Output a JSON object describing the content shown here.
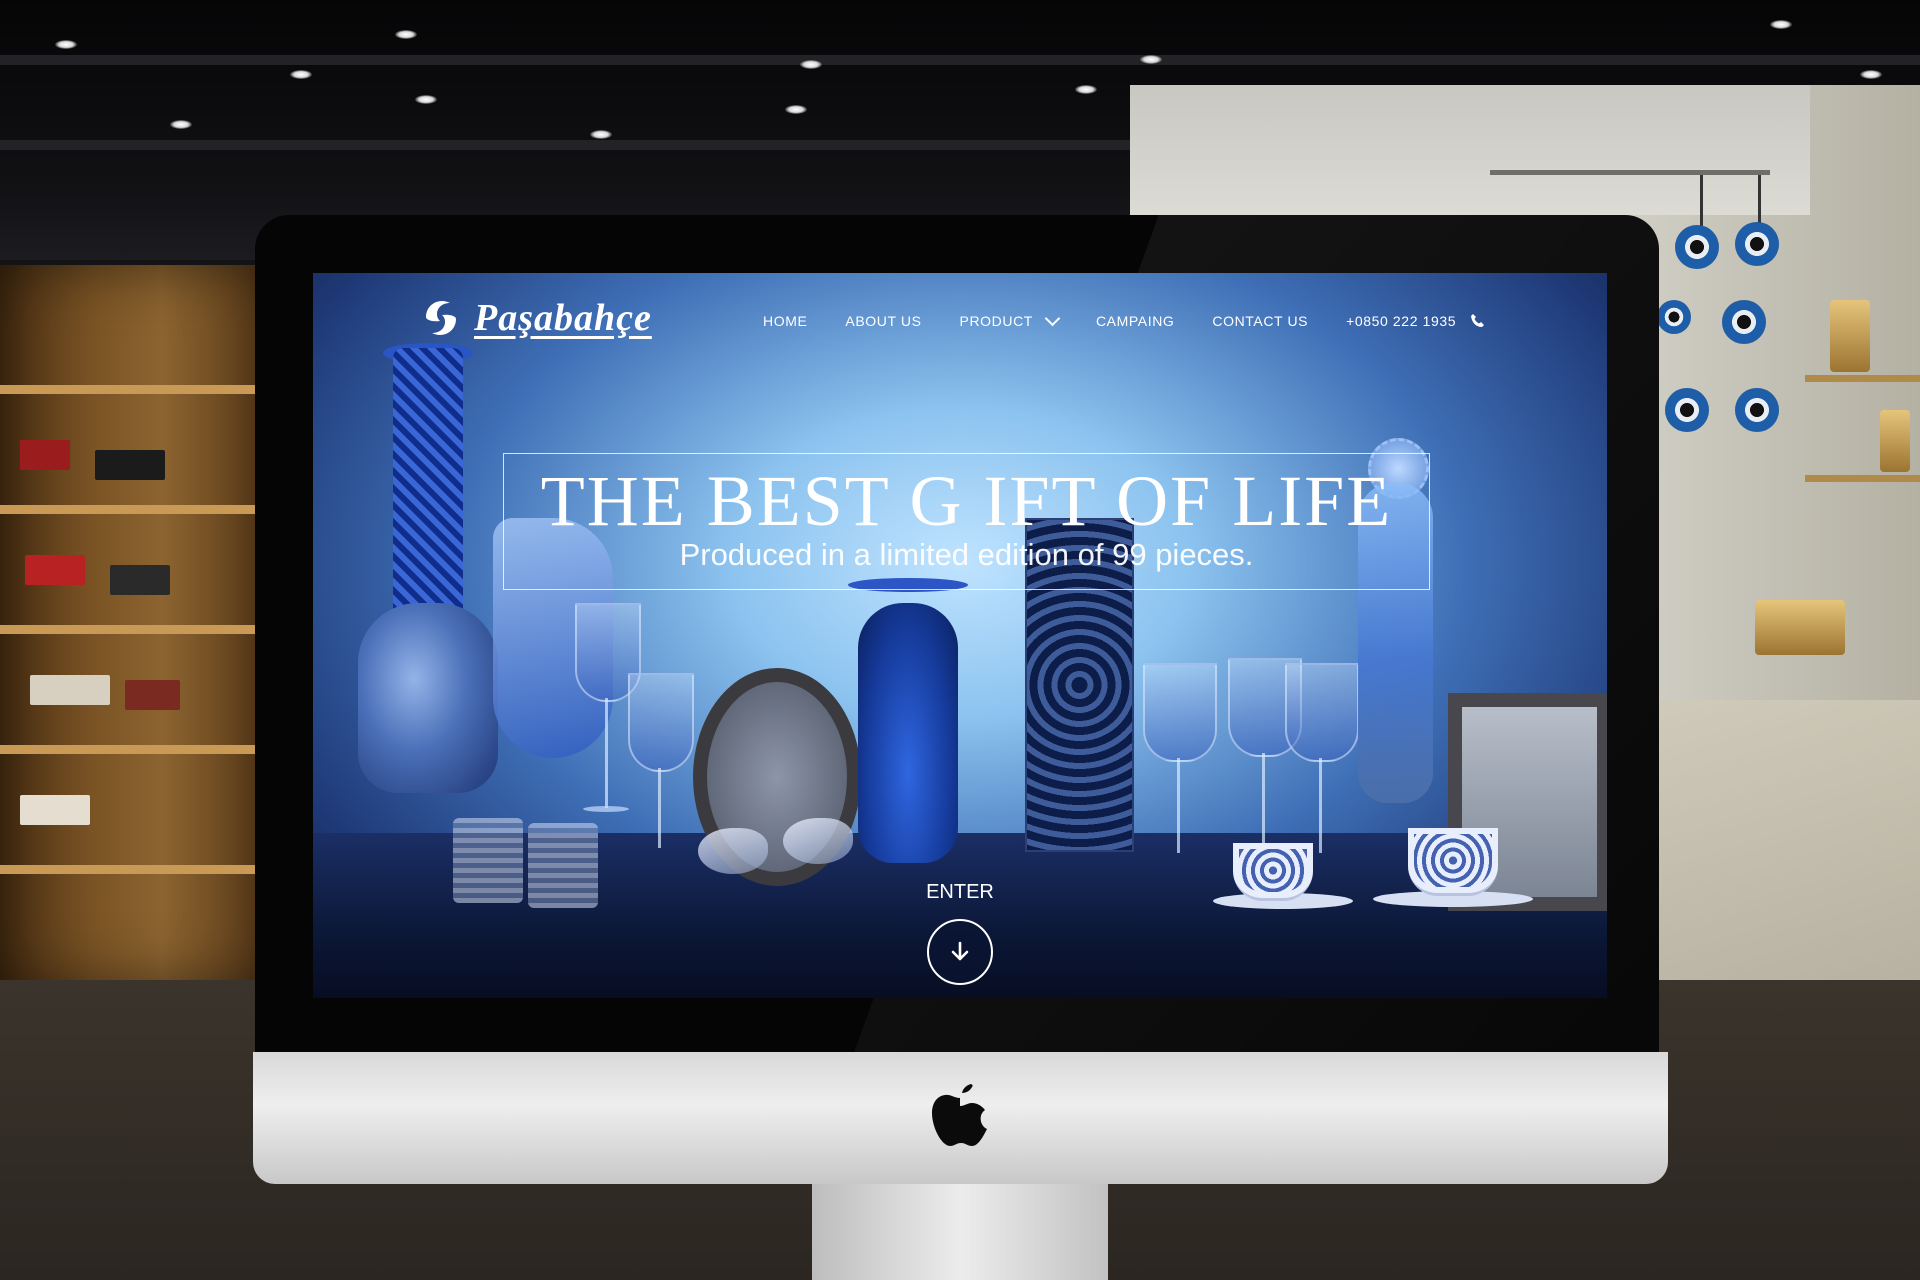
{
  "site": {
    "logo_text": "Paşabahçe"
  },
  "nav": {
    "items": [
      {
        "label": "HOME"
      },
      {
        "label": "ABOUT US"
      },
      {
        "label": "PRODUCT"
      },
      {
        "label": "CAMPAING"
      },
      {
        "label": "CONTACT US"
      }
    ],
    "phone": "+0850 222 1935"
  },
  "hero": {
    "title": "THE BEST G IFT OF LIFE",
    "subtitle": "Produced in a limited edition of 99 pieces.",
    "enter_label": "ENTER"
  },
  "icons": {
    "phone": "phone-icon",
    "dropdown": "chevron-down-icon",
    "enter": "arrow-down-icon",
    "device": "apple-logo-icon"
  },
  "colors": {
    "screen_blue": "#3f6fb6",
    "nav_text": "#ffffff"
  }
}
